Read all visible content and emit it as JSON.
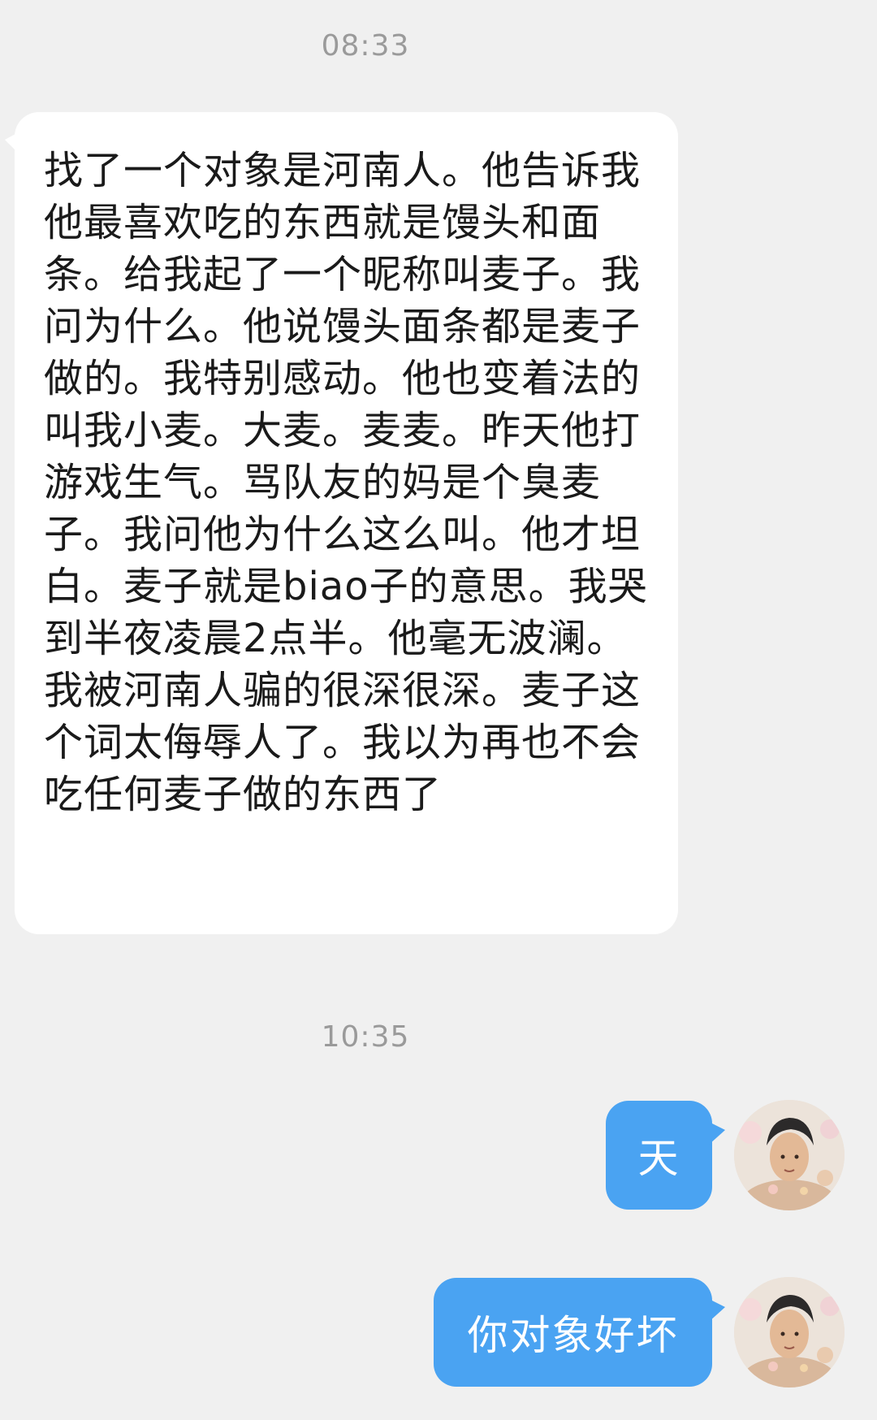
{
  "chat": {
    "messages": [
      {
        "timestamp": "08:33"
      },
      {
        "from": "them",
        "text": "找了一个对象是河南人。他告诉我他最喜欢吃的东西就是馒头和面条。给我起了一个昵称叫麦子。我问为什么。他说馒头面条都是麦子做的。我特别感动。他也变着法的叫我小麦。大麦。麦麦。昨天他打游戏生气。骂队友的妈是个臭麦子。我问他为什么这么叫。他才坦白。麦子就是biao子的意思。我哭到半夜凌晨2点半。他毫无波澜。我被河南人骗的很深很深。麦子这个词太侮辱人了。我以为再也不会吃任何麦子做的东西了"
      },
      {
        "timestamp": "10:35"
      },
      {
        "from": "me",
        "text": "天"
      },
      {
        "from": "me",
        "text": "你对象好坏"
      }
    ]
  },
  "colors": {
    "background": "#f0f0f0",
    "incoming_bubble": "#ffffff",
    "outgoing_bubble": "#4aa3f2",
    "timestamp": "#9a9a9a"
  },
  "icons": {
    "avatar": "user-avatar-icon"
  }
}
